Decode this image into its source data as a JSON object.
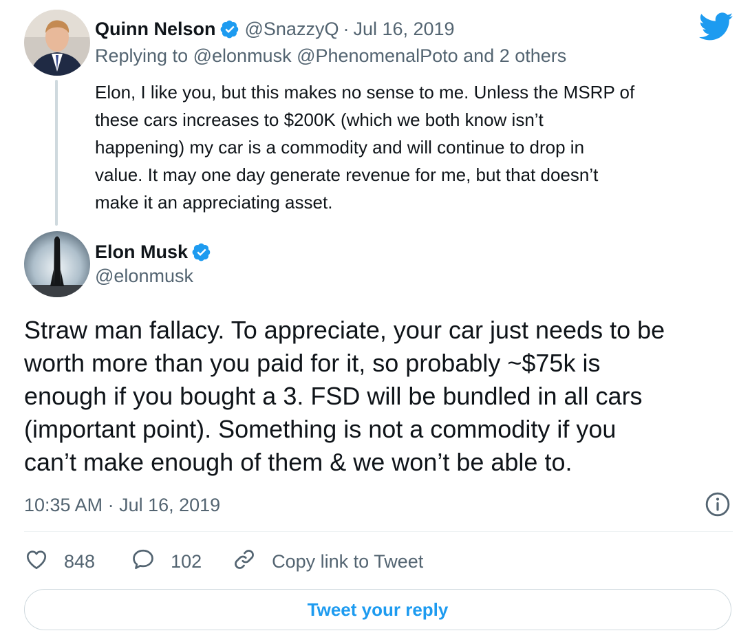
{
  "parent_tweet": {
    "author_name": "Quinn Nelson",
    "handle": "@SnazzyQ",
    "separator": "·",
    "date": "Jul 16, 2019",
    "replying_label": "Replying to",
    "replying_to": "@elonmusk @PhenomenalPoto",
    "replying_suffix": "and 2 others",
    "text": "Elon, I like you, but this makes no sense to me. Unless the MSRP of\nthese cars increases to $200K (which we both know isn’t\nhappening) my car is a commodity and will continue to drop in\nvalue. It may one day generate revenue for me, but that doesn’t\nmake it an appreciating asset."
  },
  "main_tweet": {
    "author_name": "Elon Musk",
    "handle": "@elonmusk",
    "text": "Straw man fallacy. To appreciate, your car just needs to be\nworth more than you paid for it, so probably ~$75k is\nenough if you bought a 3. FSD will be bundled in all cars\n(important point). Something is not a commodity if you\ncan’t make enough of them & we won’t be able to.",
    "timestamp": "10:35 AM · Jul 16, 2019"
  },
  "actions": {
    "likes": "848",
    "replies": "102",
    "copy_link_label": "Copy link to Tweet"
  },
  "reply_button_label": "Tweet your reply",
  "icons": {
    "brand": "twitter-bird-icon",
    "verified": "verified-badge-icon",
    "info": "info-icon",
    "like": "heart-icon",
    "reply": "speech-bubble-icon",
    "copy_link": "link-icon"
  },
  "colors": {
    "brand_blue": "#1d9bf0",
    "text_primary": "#0f1419",
    "text_muted": "#536471",
    "border": "#cfd9de"
  }
}
